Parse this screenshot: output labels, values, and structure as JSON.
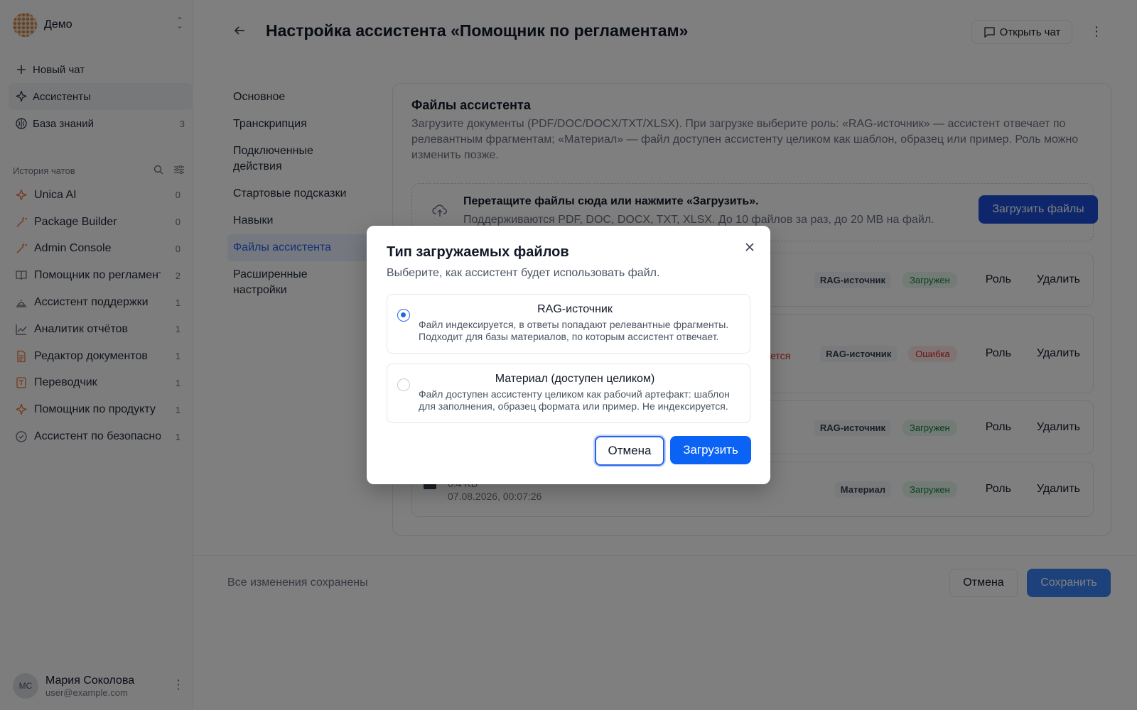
{
  "workspace": {
    "name": "Демо"
  },
  "nav": [
    {
      "icon": "plus-icon",
      "label": "Новый чат"
    },
    {
      "icon": "sparkle-icon",
      "label": "Ассистенты"
    },
    {
      "icon": "brain-icon",
      "label": "База знаний",
      "count": "3"
    }
  ],
  "history": {
    "title": "История чатов",
    "items": [
      {
        "label": "Unica AI",
        "count": "0",
        "icon": "sparkle-icon",
        "color": "#e8743b"
      },
      {
        "label": "Package Builder",
        "count": "0",
        "icon": "wand-icon",
        "color": "#e8743b"
      },
      {
        "label": "Admin Console",
        "count": "0",
        "icon": "wand-icon",
        "color": "#e8743b"
      },
      {
        "label": "Помощник по регламентам",
        "count": "2",
        "icon": "book-icon",
        "color": "#6b7280"
      },
      {
        "label": "Ассистент поддержки",
        "count": "1",
        "icon": "bell-icon",
        "color": "#6b7280"
      },
      {
        "label": "Аналитик отчётов",
        "count": "1",
        "icon": "chart-icon",
        "color": "#6b7280"
      },
      {
        "label": "Редактор документов",
        "count": "1",
        "icon": "document-icon",
        "color": "#e8743b"
      },
      {
        "label": "Переводчик",
        "count": "1",
        "icon": "translate-icon",
        "color": "#e8743b"
      },
      {
        "label": "Помощник по продукту",
        "count": "1",
        "icon": "sparkle-icon",
        "color": "#e8743b"
      },
      {
        "label": "Ассистент по безопасности",
        "count": "1",
        "icon": "check-circle-icon",
        "color": "#6b7280"
      }
    ]
  },
  "user": {
    "initials": "МС",
    "name": "Мария Соколова",
    "email": "user@example.com"
  },
  "header": {
    "title": "Настройка ассистента «Помощник по регламентам»",
    "open_chat": "Открыть чат"
  },
  "settings_nav": [
    {
      "label": "Основное"
    },
    {
      "label": "Транскрипция"
    },
    {
      "label": "Подключенные действия"
    },
    {
      "label": "Стартовые подсказки"
    },
    {
      "label": "Навыки"
    },
    {
      "label": "Файлы ассистента",
      "active": true
    },
    {
      "label": "Расширенные настройки"
    }
  ],
  "files_card": {
    "title": "Файлы ассистента",
    "description": "Загрузите документы (PDF/DOC/DOCX/TXT/XLSX). При загрузке выберите роль: «RAG-источник» — ассистент отвечает по релевантным фрагментам; «Материал» — файл доступен ассистенту целиком как шаблон, образец или пример. Роль можно изменить позже.",
    "drop_title": "Перетащите файлы сюда или нажмите «Загрузить».",
    "drop_hint": "Поддерживаются PDF, DOC, DOCX, TXT, XLSX. До 10 файлов за раз, до 20 MB на файл.",
    "upload_button": "Загрузить файлы",
    "role_button": "Роль",
    "delete_button": "Удалить",
    "files": [
      {
        "role": "RAG-источник",
        "status": "Загружен",
        "status_type": "ok"
      },
      {
        "role": "RAG-источник",
        "status": "Ошибка",
        "status_type": "error",
        "note": "ется"
      },
      {
        "role": "RAG-источник",
        "status": "Загружен",
        "status_type": "ok"
      },
      {
        "role": "Материал",
        "status": "Загружен",
        "status_type": "ok",
        "size": "0.4 KB",
        "date": "07.08.2026, 00:07:26"
      }
    ]
  },
  "footer": {
    "saved": "Все изменения сохранены",
    "cancel": "Отмена",
    "save": "Сохранить"
  },
  "modal": {
    "title": "Тип загружаемых файлов",
    "subtitle": "Выберите, как ассистент будет использовать файл.",
    "options": [
      {
        "title": "RAG-источник",
        "desc": "Файл индексируется, в ответы попадают релевантные фрагменты. Подходит для базы материалов, по которым ассистент отвечает.",
        "selected": true
      },
      {
        "title": "Материал (доступен целиком)",
        "desc": "Файл доступен ассистенту целиком как рабочий артефакт: шаблон для заполнения, образец формата или пример. Не индексируется.",
        "selected": false
      }
    ],
    "cancel": "Отмена",
    "upload": "Загрузить"
  },
  "colors": {
    "accent": "#0b63f6",
    "error": "#dc2626",
    "success": "#15803d",
    "overlay": "rgba(0,0,0,0.5)"
  }
}
